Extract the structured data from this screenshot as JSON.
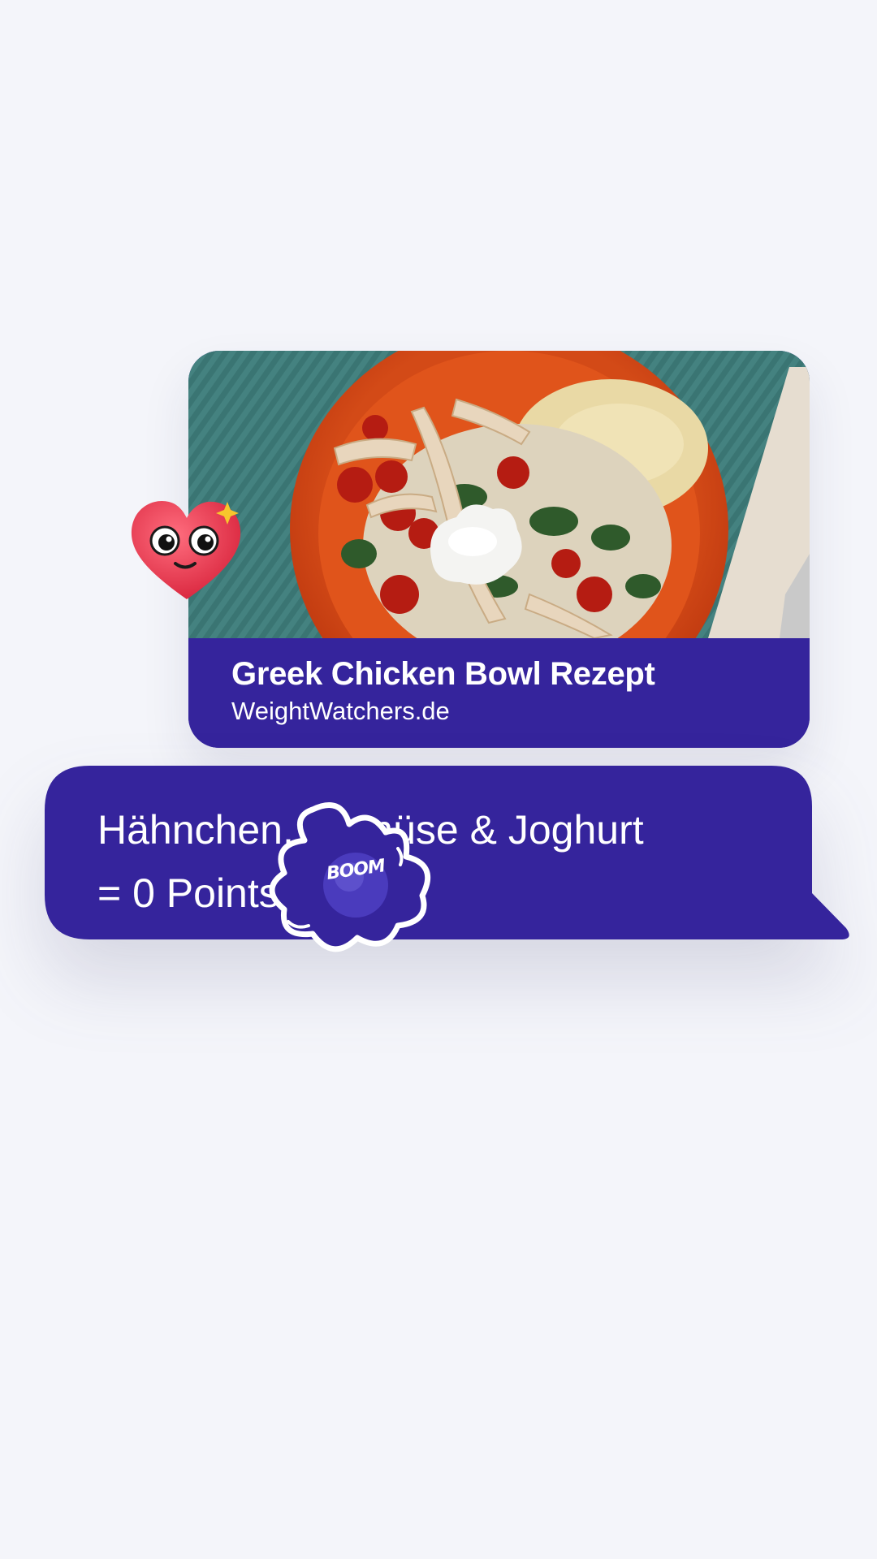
{
  "link_card": {
    "title": "Greek Chicken Bowl Rezept",
    "source": "WeightWatchers.de",
    "image_icon": "food-photo"
  },
  "message": {
    "line1": "Hähnchen, Gemüse & Joghurt",
    "line2": "= 0 Points."
  },
  "stickers": {
    "heart_icon": "smiling-heart-icon",
    "boom_icon": "boom-burst-icon",
    "boom_label": "BOOM"
  },
  "colors": {
    "background": "#f4f5fa",
    "brand_indigo": "#35249c",
    "text": "#ffffff",
    "heart_red": "#e8344c",
    "sparkle_yellow": "#f7c62c"
  }
}
